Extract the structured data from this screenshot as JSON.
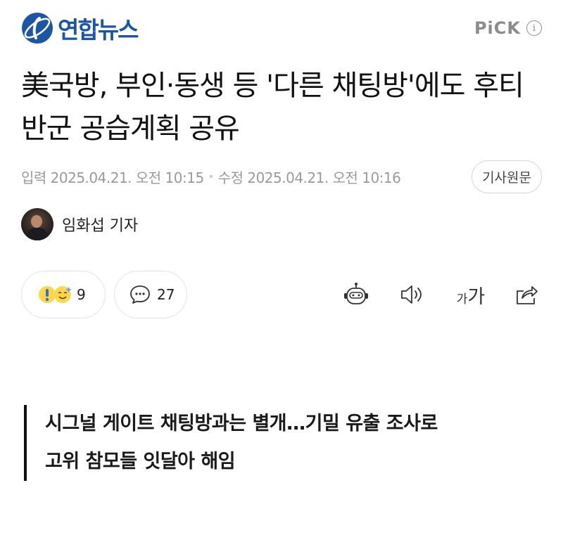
{
  "header": {
    "logo_text": "연합뉴스",
    "pick_label": "PiCK",
    "info_glyph": "i",
    "brand_color": "#1b56a6"
  },
  "article": {
    "title": "美국방, 부인·동생 등 '다른 채팅방'에도 후티반군 공습계획 공유",
    "published": "입력 2025.04.21. 오전 10:15",
    "modified": "수정 2025.04.21. 오전 10:16",
    "original_button": "기사원문",
    "reporter": "임화섭 기자",
    "subheadline_lines": [
      "시그널 게이트 채팅방과는 별개…기밀 유출 조사로",
      "고위 참모들 잇달아 해임"
    ]
  },
  "actions": {
    "reaction_count": "9",
    "comment_count": "27",
    "font_size_small": "가",
    "font_size_large": "가",
    "icons": [
      "reaction-emoji-icon",
      "comment-icon",
      "ai-summary-bot-icon",
      "audio-speaker-icon",
      "font-size-icon",
      "share-icon"
    ]
  }
}
